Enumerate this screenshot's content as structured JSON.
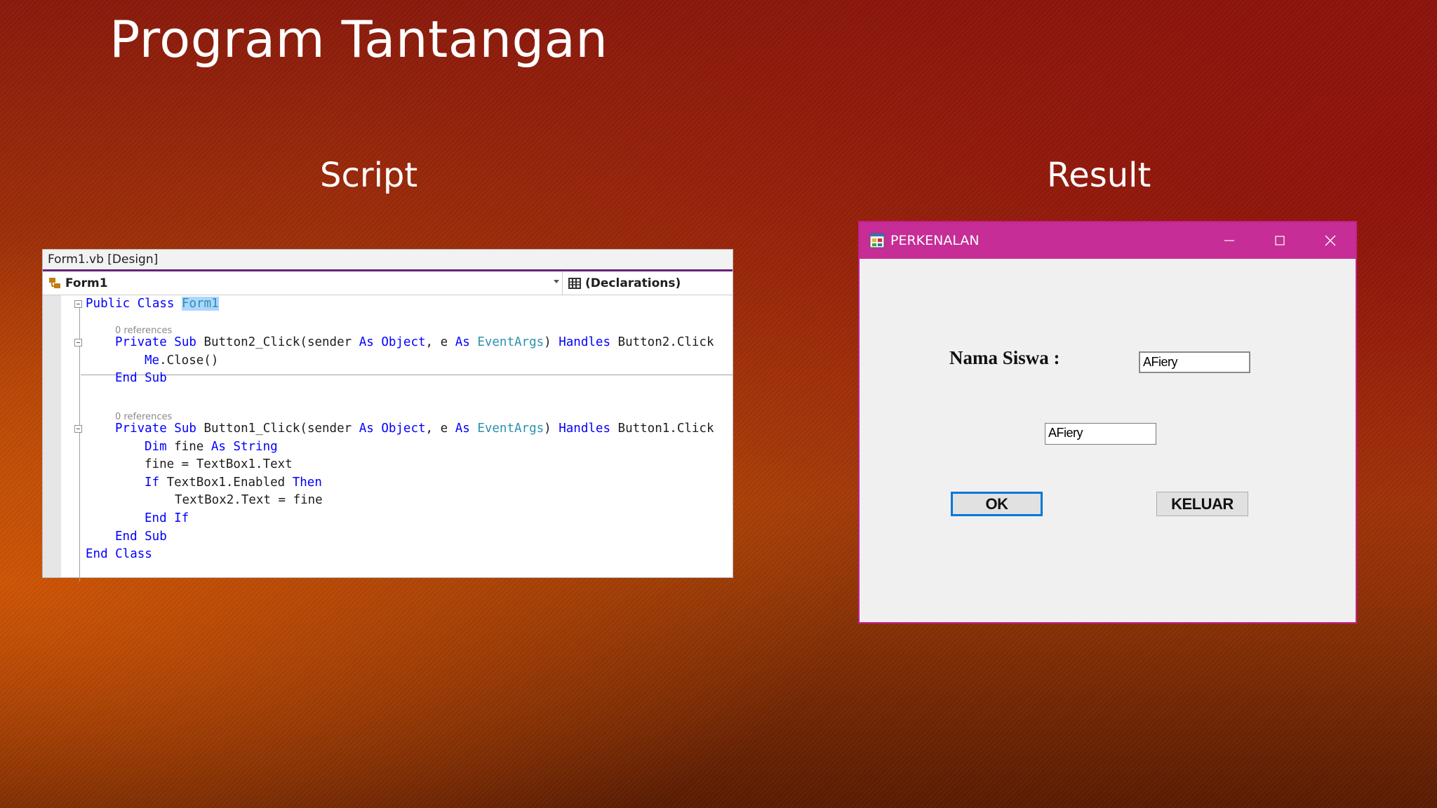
{
  "slide": {
    "title": "Program Tantangan",
    "script_heading": "Script",
    "result_heading": "Result"
  },
  "editor": {
    "tab_title": "Form1.vb [Design]",
    "class_dropdown": "Form1",
    "member_dropdown": "(Declarations)",
    "codelens_refs": [
      "0 references",
      "0 references"
    ],
    "code": {
      "l1": [
        "Public Class ",
        "Form1"
      ],
      "l2": [
        "Private Sub",
        " Button2_Click(sender ",
        "As",
        " ",
        "Object",
        ", e ",
        "As",
        " ",
        "EventArgs",
        ") ",
        "Handles",
        " Button2.Click"
      ],
      "l3": [
        "Me",
        ".Close()"
      ],
      "l4": "End Sub",
      "l5": [
        "Private Sub",
        " Button1_Click(sender ",
        "As",
        " ",
        "Object",
        ", e ",
        "As",
        " ",
        "EventArgs",
        ") ",
        "Handles",
        " Button1.Click"
      ],
      "l6": [
        "Dim",
        " fine ",
        "As",
        " ",
        "String"
      ],
      "l7": "fine = TextBox1.Text",
      "l8": [
        "If",
        " TextBox1.Enabled ",
        "Then"
      ],
      "l9": "TextBox2.Text = fine",
      "l10": "End If",
      "l11": "End Sub",
      "l12": "End Class"
    }
  },
  "result_window": {
    "title": "PERKENALAN",
    "label": "Nama Siswa :",
    "textbox1_value": "AFiery",
    "textbox2_value": "AFiery",
    "ok_button": "OK",
    "exit_button": "KELUAR"
  },
  "colors": {
    "titlebar": "#c62d96",
    "keyword": "#0000ff",
    "type": "#2b91af",
    "focus_border": "#0078d7"
  }
}
